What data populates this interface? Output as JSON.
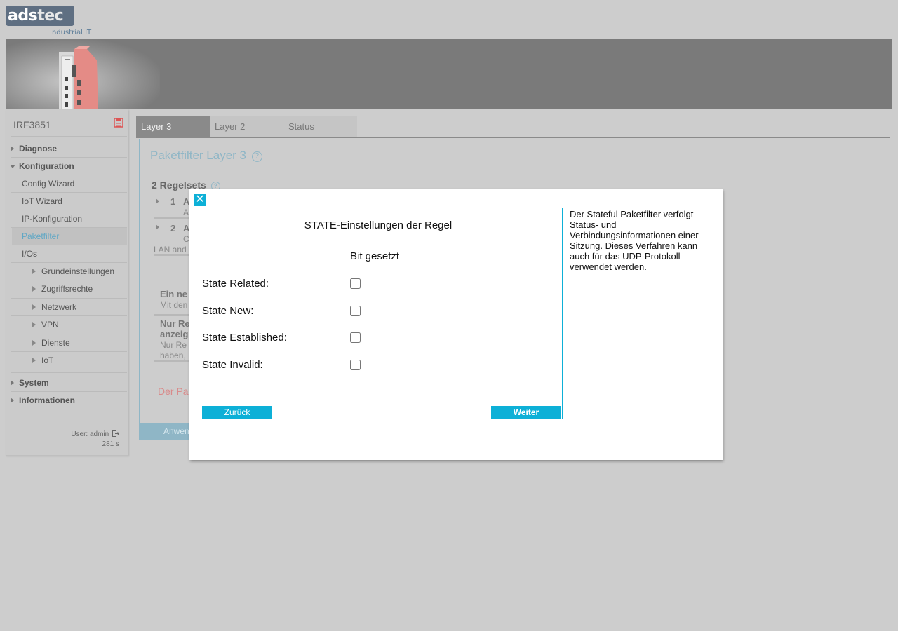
{
  "header": {
    "logo_main": "ads",
    "logo_accent": "tec",
    "logo_sub": "Industrial IT"
  },
  "sidebar": {
    "device_name": "IRF3851",
    "items": [
      {
        "label": "Diagnose"
      },
      {
        "label": "Konfiguration"
      },
      {
        "label": "Config Wizard"
      },
      {
        "label": "IoT Wizard"
      },
      {
        "label": "IP-Konfiguration"
      },
      {
        "label": "Paketfilter"
      },
      {
        "label": "I/Os"
      },
      {
        "label": "Grundeinstellungen"
      },
      {
        "label": "Zugriffsrechte"
      },
      {
        "label": "Netzwerk"
      },
      {
        "label": "VPN"
      },
      {
        "label": "Dienste"
      },
      {
        "label": "IoT"
      },
      {
        "label": "System"
      },
      {
        "label": "Informationen"
      }
    ],
    "user": "User: admin",
    "session_time": "281 s"
  },
  "tabs": [
    {
      "label": "Layer 3"
    },
    {
      "label": "Layer 2"
    },
    {
      "label": "Status"
    }
  ],
  "main": {
    "title": "Paketfilter Layer 3",
    "ruleset_title": "2 Regelsets",
    "bg_rows": [
      {
        "num": "1",
        "name": "A",
        "sub": "A"
      },
      {
        "num": "2",
        "name": "A",
        "sub": "C"
      }
    ],
    "bg_lan": "LAN and",
    "bg_new_title": "Ein ne",
    "bg_new_sub": "Mit den",
    "bg_only_title_1": "Nur Re",
    "bg_only_title_2": "anzeig",
    "bg_only_sub_1": "Nur Re",
    "bg_only_sub_2": "haben,",
    "bg_warning": "Der Pa",
    "apply_label": "Anwen"
  },
  "modal": {
    "title": "STATE-Einstellungen der Regel",
    "column_header": "Bit gesetzt",
    "states": [
      {
        "label": "State Related:",
        "checked": false
      },
      {
        "label": "State New:",
        "checked": false
      },
      {
        "label": "State Established:",
        "checked": false
      },
      {
        "label": "State Invalid:",
        "checked": false
      }
    ],
    "back_label": "Zurück",
    "next_label": "Weiter",
    "info": "Der Stateful Paketfilter verfolgt Status- und Verbindungsinformationen einer Sitzung. Dieses Verfahren kann auch für das UDP-Protokoll verwendet werden.",
    "close_icon": "close-icon",
    "accent_color": "#0db0d7"
  }
}
